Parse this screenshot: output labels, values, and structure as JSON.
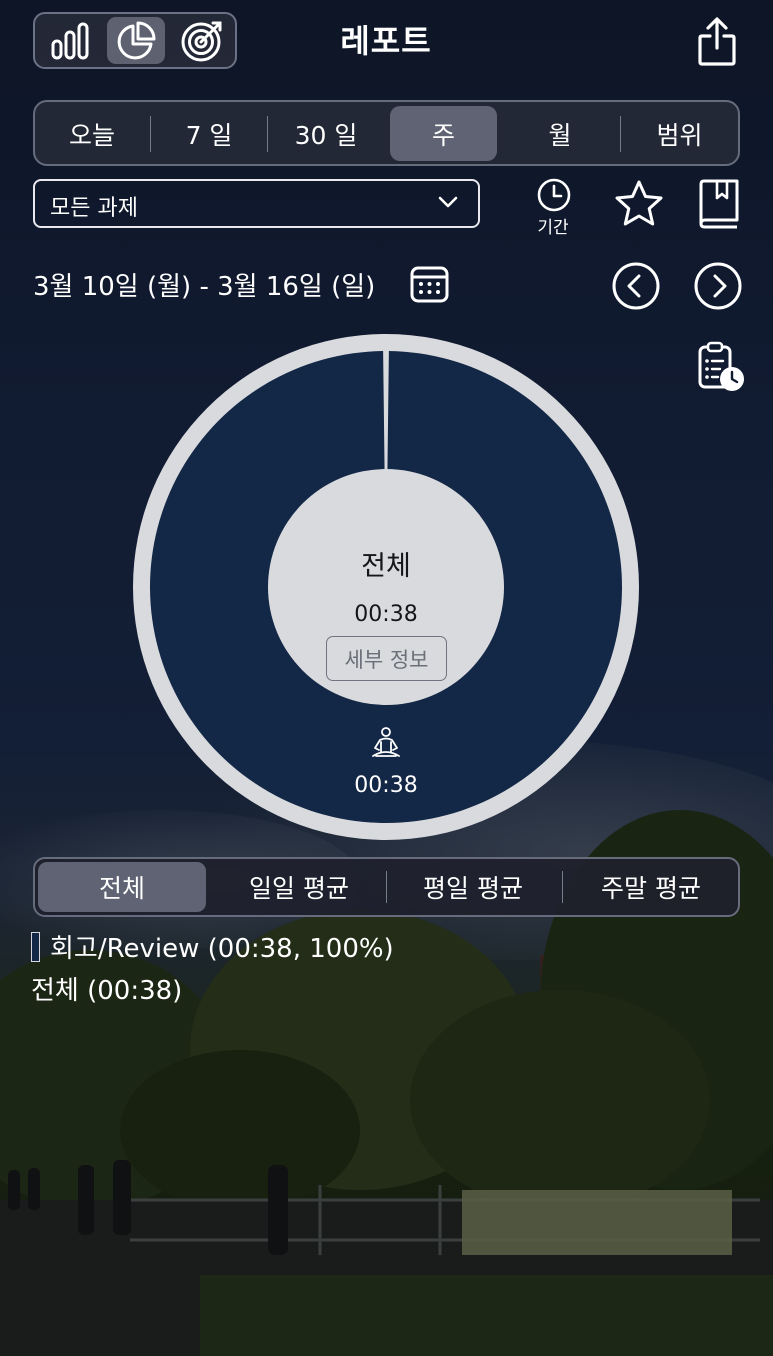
{
  "header": {
    "title": "레포트",
    "modes": [
      {
        "name": "bar-chart",
        "active": false
      },
      {
        "name": "pie-chart",
        "active": true
      },
      {
        "name": "target",
        "active": false
      }
    ]
  },
  "period_tabs": [
    {
      "label": "오늘",
      "active": false
    },
    {
      "label": "7 일",
      "active": false
    },
    {
      "label": "30 일",
      "active": false
    },
    {
      "label": "주",
      "active": true
    },
    {
      "label": "월",
      "active": false
    },
    {
      "label": "범위",
      "active": false
    }
  ],
  "filter": {
    "task_select": "모든 과제",
    "period_icon_label": "기간"
  },
  "date_range": "3월 10일 (월) - 3월 16일 (일)",
  "chart_data": {
    "type": "pie",
    "center": {
      "title": "전체",
      "total": "00:38",
      "detail_button": "세부 정보"
    },
    "slices": [
      {
        "label": "회고/Review",
        "value_minutes": 38,
        "percent": 100,
        "display_time": "00:38",
        "color": "#132746",
        "icon": "meditation-icon"
      }
    ]
  },
  "avg_tabs": [
    {
      "label": "전체",
      "active": true
    },
    {
      "label": "일일 평균",
      "active": false
    },
    {
      "label": "평일 평균",
      "active": false
    },
    {
      "label": "주말 평균",
      "active": false
    }
  ],
  "legend": {
    "items": [
      {
        "text": "회고/Review (00:38, 100%)",
        "color": "#132746"
      }
    ],
    "total_text": "전체 (00:38)"
  },
  "colors": {
    "slice": "#132746",
    "ring": "#d9dade",
    "center_disk": "#d9dade",
    "active_segment": "#5f6373"
  }
}
